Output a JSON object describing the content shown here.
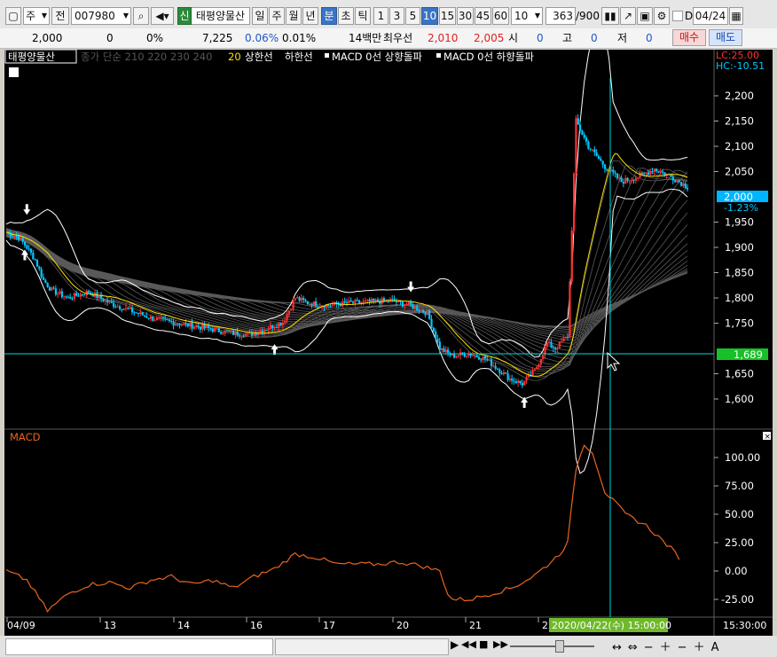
{
  "toolbar": {
    "market": "주",
    "period_prefix": "전",
    "code": "007980",
    "stock_name": "태평양물산",
    "shin_badge": "신",
    "periods": [
      "일",
      "주",
      "월",
      "년",
      "분",
      "초",
      "틱"
    ],
    "active_period": "분",
    "intervals": [
      "1",
      "3",
      "5",
      "10",
      "15",
      "30",
      "45",
      "60"
    ],
    "active_interval": "10",
    "interval_select": "10",
    "count": "363",
    "count_total": "/900",
    "d_label": "D",
    "date": "04/24"
  },
  "quote": {
    "price": "2,000",
    "change": "0",
    "change_pct": "0%",
    "volume": "7,225",
    "vol_rate1": "0.06%",
    "vol_rate2": "0.01%",
    "label_1": "14백만",
    "best_ask_label": "최우선",
    "best_ask": "2,010",
    "best_bid": "2,005",
    "open_label": "시",
    "open": "0",
    "high_label": "고",
    "high": "0",
    "low_label": "저",
    "low": "0",
    "buy_label": "매수",
    "sell_label": "매도"
  },
  "legend": {
    "stock": "태평양물산",
    "ma_text": "종가 단순 210  220  230  240",
    "bb_period": "20",
    "bb_upper": "상한선",
    "bb_lower": "하한선",
    "signal1": "MACD 0선 상향돌파",
    "signal2": "MACD 0선 하향돌파",
    "lc": "LC:25.00",
    "hc": "HC:-10.51"
  },
  "price_axis": {
    "ticks": [
      "2,200",
      "2,150",
      "2,100",
      "2,050",
      "2,000",
      "1,950",
      "1,900",
      "1,850",
      "1,800",
      "1,750",
      "1,700",
      "1,650",
      "1,600"
    ],
    "current_price": "2,000",
    "current_change": "-1.23%",
    "crosshair_price": "1,689"
  },
  "macd_panel": {
    "title": "MACD",
    "ticks": [
      "100.00",
      "75.00",
      "50.00",
      "25.00",
      "0.00",
      "-25.00"
    ]
  },
  "time_axis": {
    "labels": [
      "04/09",
      "13",
      "14",
      "16",
      "17",
      "20",
      "21",
      "22"
    ],
    "crosshair_time": "2020/04/22(수) 15:00:00",
    "right_time": "15:30:00"
  },
  "colors": {
    "up": "#ff3030",
    "down": "#00c8ff",
    "crosshair": "#00d6e0",
    "macd": "#e8641e",
    "ma20": "#ffe000",
    "active_blue": "#3a74c4",
    "current_price_bg": "#00b4ff",
    "crosshair_price_bg": "#18c028"
  },
  "chart_data": {
    "type": "candlestick",
    "interval": "10분",
    "sessions": [
      "04/09",
      "13",
      "14",
      "16",
      "17",
      "20",
      "21",
      "22"
    ],
    "price_range": [
      1560,
      2260
    ],
    "macd_range": [
      -40,
      115
    ],
    "close_path": [
      [
        0,
        1930
      ],
      [
        6,
        1920
      ],
      [
        10,
        1900
      ],
      [
        14,
        1875
      ],
      [
        18,
        1835
      ],
      [
        22,
        1815
      ],
      [
        30,
        1800
      ],
      [
        40,
        1812
      ],
      [
        50,
        1790
      ],
      [
        60,
        1775
      ],
      [
        70,
        1760
      ],
      [
        80,
        1752
      ],
      [
        90,
        1745
      ],
      [
        100,
        1738
      ],
      [
        110,
        1730
      ],
      [
        118,
        1728
      ],
      [
        126,
        1740
      ],
      [
        134,
        1752
      ],
      [
        140,
        1800
      ],
      [
        146,
        1790
      ],
      [
        156,
        1785
      ],
      [
        166,
        1790
      ],
      [
        176,
        1792
      ],
      [
        186,
        1795
      ],
      [
        196,
        1785
      ],
      [
        204,
        1770
      ],
      [
        210,
        1700
      ],
      [
        216,
        1685
      ],
      [
        224,
        1690
      ],
      [
        232,
        1680
      ],
      [
        238,
        1660
      ],
      [
        244,
        1640
      ],
      [
        250,
        1630
      ],
      [
        256,
        1655
      ],
      [
        262,
        1710
      ],
      [
        266,
        1700
      ],
      [
        272,
        1725
      ],
      [
        276,
        2150
      ],
      [
        282,
        2100
      ],
      [
        290,
        2060
      ],
      [
        298,
        2030
      ],
      [
        306,
        2040
      ],
      [
        314,
        2055
      ],
      [
        322,
        2040
      ],
      [
        330,
        2020
      ]
    ],
    "macd_path": [
      [
        0,
        0
      ],
      [
        10,
        -8
      ],
      [
        20,
        -35
      ],
      [
        30,
        -20
      ],
      [
        40,
        -12
      ],
      [
        50,
        -10
      ],
      [
        60,
        -15
      ],
      [
        70,
        -8
      ],
      [
        80,
        -5
      ],
      [
        90,
        -12
      ],
      [
        100,
        -8
      ],
      [
        110,
        -15
      ],
      [
        120,
        -5
      ],
      [
        130,
        2
      ],
      [
        140,
        15
      ],
      [
        150,
        12
      ],
      [
        160,
        6
      ],
      [
        170,
        6
      ],
      [
        180,
        6
      ],
      [
        190,
        8
      ],
      [
        200,
        5
      ],
      [
        210,
        0
      ],
      [
        215,
        -25
      ],
      [
        225,
        -25
      ],
      [
        235,
        -20
      ],
      [
        245,
        -15
      ],
      [
        255,
        -5
      ],
      [
        262,
        5
      ],
      [
        268,
        15
      ],
      [
        272,
        25
      ],
      [
        276,
        90
      ],
      [
        280,
        112
      ],
      [
        284,
        105
      ],
      [
        290,
        70
      ],
      [
        300,
        50
      ],
      [
        310,
        40
      ],
      [
        316,
        30
      ],
      [
        322,
        20
      ],
      [
        326,
        12
      ]
    ],
    "crosshair": {
      "time": "2020/04/22(수) 15:00:00",
      "price": 1689
    }
  }
}
